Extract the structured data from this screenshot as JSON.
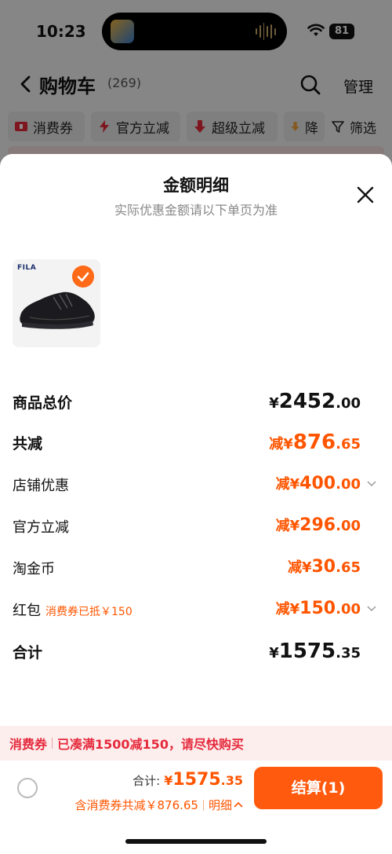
{
  "status_bar": {
    "time": "10:23",
    "battery": "81"
  },
  "nav": {
    "title": "购物车",
    "count": "(269)",
    "manage": "管理"
  },
  "filters": [
    {
      "label": "消费券",
      "icon": "coupon-icon",
      "color": "#e5283a"
    },
    {
      "label": "官方立减",
      "icon": "lightning-icon",
      "color": "#e5283a"
    },
    {
      "label": "超级立减",
      "icon": "down-arrow-icon",
      "color": "#e5283a"
    },
    {
      "label": "降",
      "icon": "down-arrow-icon",
      "color": "#f2a33a"
    },
    {
      "label": "筛选",
      "icon": "filter-icon",
      "color": "#222"
    }
  ],
  "sheet": {
    "title": "金额明细",
    "subtitle": "实际优惠金额请以下单页为准",
    "product": {
      "brand": "FILA"
    },
    "rows": {
      "subtotal": {
        "label": "商品总价",
        "prefix": "¥",
        "int": "2452",
        "dec": ".00"
      },
      "total_discount": {
        "label": "共减",
        "prefix": "减¥",
        "int": "876",
        "dec": ".65"
      },
      "shop_discount": {
        "label": "店铺优惠",
        "prefix": "减¥",
        "int": "400",
        "dec": ".00"
      },
      "official_discount": {
        "label": "官方立减",
        "prefix": "减¥",
        "int": "296",
        "dec": ".00"
      },
      "taojinbi": {
        "label": "淘金币",
        "prefix": "减¥",
        "int": "30",
        "dec": ".65"
      },
      "red_packet": {
        "label": "红包",
        "tag": "消费券已抵￥150",
        "prefix": "减¥",
        "int": "150",
        "dec": ".00"
      },
      "total": {
        "label": "合计",
        "prefix": "¥",
        "int": "1575",
        "dec": ".35"
      }
    }
  },
  "promo_bar": {
    "label": "消费券",
    "message": "已凑满1500减150，请尽快购买"
  },
  "footer": {
    "total_label": "合计:",
    "total_prefix": "¥",
    "total_int": "1575",
    "total_dec": ".35",
    "discount_text": "含消费券共减￥876.65",
    "detail_label": "明细",
    "checkout_label": "结算(1)"
  },
  "colors": {
    "accent": "#ff5500",
    "checkout": "#ff5a0e",
    "promo_bg": "#fdeeee",
    "promo_text": "#e52a3c"
  }
}
